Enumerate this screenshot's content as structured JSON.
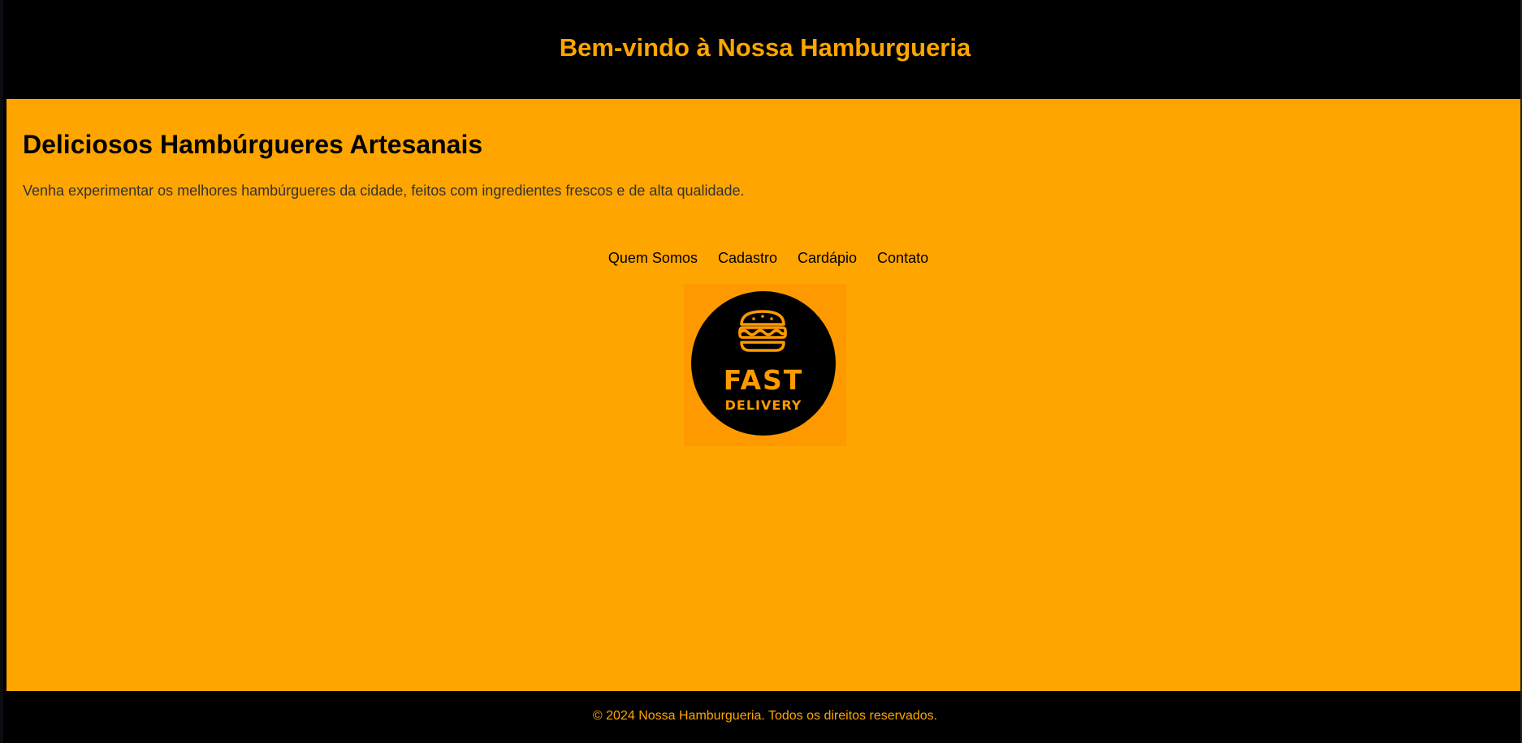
{
  "header": {
    "title": "Bem-vindo à Nossa Hamburgueria"
  },
  "hero": {
    "title": "Deliciosos Hambúrgueres Artesanais",
    "text": "Venha experimentar os melhores hambúrgueres da cidade, feitos com ingredientes frescos e de alta qualidade."
  },
  "nav": {
    "items": [
      {
        "label": "Quem Somos"
      },
      {
        "label": "Cadastro"
      },
      {
        "label": "Cardápio"
      },
      {
        "label": "Contato"
      }
    ]
  },
  "logo": {
    "line1": "FAST",
    "line2": "DELIVERY",
    "icon": "burger-icon"
  },
  "footer": {
    "text": "© 2024 Nossa Hamburgueria. Todos os direitos reservados."
  },
  "colors": {
    "accent": "#FFA500",
    "background_dark": "#000000",
    "logo_bg": "#FF9900"
  }
}
